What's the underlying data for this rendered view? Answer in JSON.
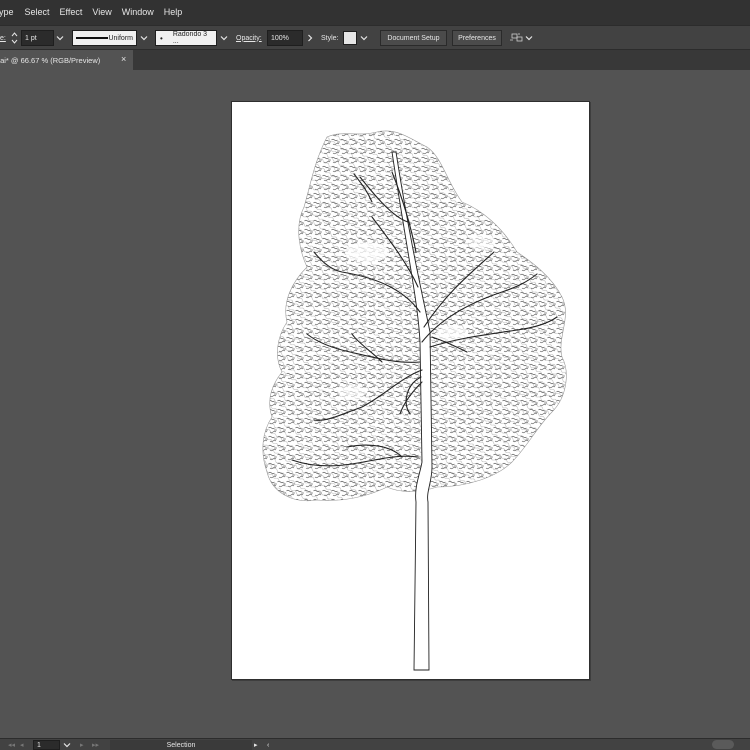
{
  "menubar": {
    "items": [
      "ype",
      "Select",
      "Effect",
      "View",
      "Window",
      "Help"
    ]
  },
  "controlbar": {
    "stroke_label": "e:",
    "stroke_weight": "1 pt",
    "variable_width_profile": "Uniform",
    "brush_definition": "Radondo 3 ...",
    "opacity_label": "Opacity:",
    "opacity_value": "100%",
    "style_label": "Style:",
    "document_setup_label": "Document Setup",
    "preferences_label": "Preferences"
  },
  "tab": {
    "title": ".ai* @ 66.67 % (RGB/Preview)",
    "close_glyph": "×"
  },
  "statusbar": {
    "artboard_number": "1",
    "status_text": "Selection"
  },
  "colors": {
    "menubar_bg": "#323232",
    "controlbar_bg": "#424242",
    "canvas_bg": "#535353",
    "artboard_bg": "#ffffff"
  },
  "icons": [
    "stepper-icon",
    "chevron-down-icon",
    "arrange-documents-icon",
    "nav-first-icon",
    "nav-prev-icon",
    "nav-next-icon",
    "nav-last-icon",
    "play-icon",
    "back-icon"
  ]
}
